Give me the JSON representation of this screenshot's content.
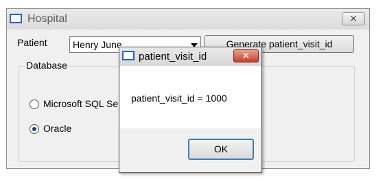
{
  "main_window": {
    "title": "Hospital",
    "close_glyph": "✕",
    "patient_label": "Patient",
    "patient_selected": "Henry June",
    "generate_button_label": "Generate patient_visit_id",
    "database_group": {
      "legend": "Database",
      "options": [
        {
          "label": "Microsoft SQL Se",
          "checked": false
        },
        {
          "label": "Oracle",
          "checked": true
        }
      ]
    }
  },
  "dialog": {
    "title": "patient_visit_id",
    "close_glyph": "✕",
    "message": "patient_visit_id = 1000",
    "ok_label": "OK"
  },
  "colors": {
    "dialog_close_red": "#c4412b",
    "focus_blue": "#3c7fb1",
    "window_bg": "#f0f0f0"
  }
}
